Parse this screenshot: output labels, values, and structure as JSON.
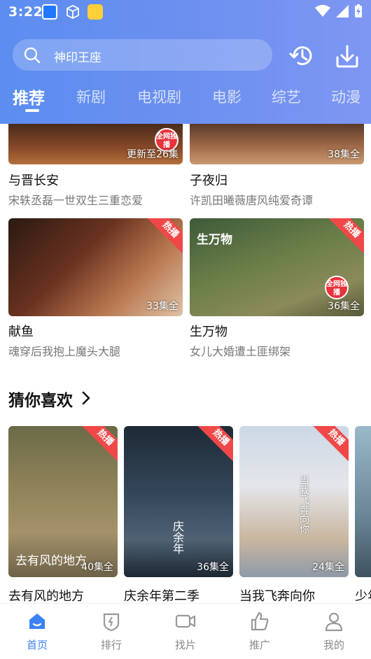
{
  "status_bar": {
    "time": "3:22"
  },
  "search": {
    "text": "神印王座"
  },
  "tabs": [
    {
      "label": "推荐",
      "active": true
    },
    {
      "label": "新剧"
    },
    {
      "label": "电视剧"
    },
    {
      "label": "电影"
    },
    {
      "label": "综艺"
    },
    {
      "label": "动漫"
    }
  ],
  "top_row": [
    {
      "title": "与晋长安",
      "desc": "宋轶丞磊一世双生三重恋爱",
      "episodes": "更新至26集",
      "badge": "全网独播"
    },
    {
      "title": "子夜归",
      "desc": "许凯田曦薇唐风纯爱奇谭",
      "episodes": "38集全"
    }
  ],
  "second_row": [
    {
      "title": "献鱼",
      "desc": "魂穿后我抱上魔头大腿",
      "episodes": "33集全",
      "hot": "热播"
    },
    {
      "title": "生万物",
      "desc": "女儿大婚遭土匪绑架",
      "episodes": "36集全",
      "hot": "热播",
      "badge": "全网独播",
      "poster_logo": "生万物"
    }
  ],
  "guess_section": {
    "title": "猜你喜欢",
    "items": [
      {
        "title": "去有风的地方",
        "episodes": "40集全",
        "hot": "热播",
        "poster_text": "去有风的地方"
      },
      {
        "title": "庆余年第二季",
        "episodes": "36集全",
        "hot": "热播",
        "poster_text": "庆余年"
      },
      {
        "title": "当我飞奔向你",
        "episodes": "24集全",
        "hot": "热播",
        "poster_text": "当我飞奔向你"
      },
      {
        "title": "少年"
      }
    ]
  },
  "bottom_nav": [
    {
      "label": "首页",
      "icon": "home-icon",
      "active": true
    },
    {
      "label": "排行",
      "icon": "ranking-icon"
    },
    {
      "label": "找片",
      "icon": "video-camera-icon"
    },
    {
      "label": "推广",
      "icon": "thumbs-up-icon"
    },
    {
      "label": "我的",
      "icon": "profile-icon"
    }
  ],
  "colors": {
    "accent": "#3b82f6",
    "hot": "#f04848",
    "header_start": "#5b8ef0",
    "header_end": "#7e97f2"
  }
}
